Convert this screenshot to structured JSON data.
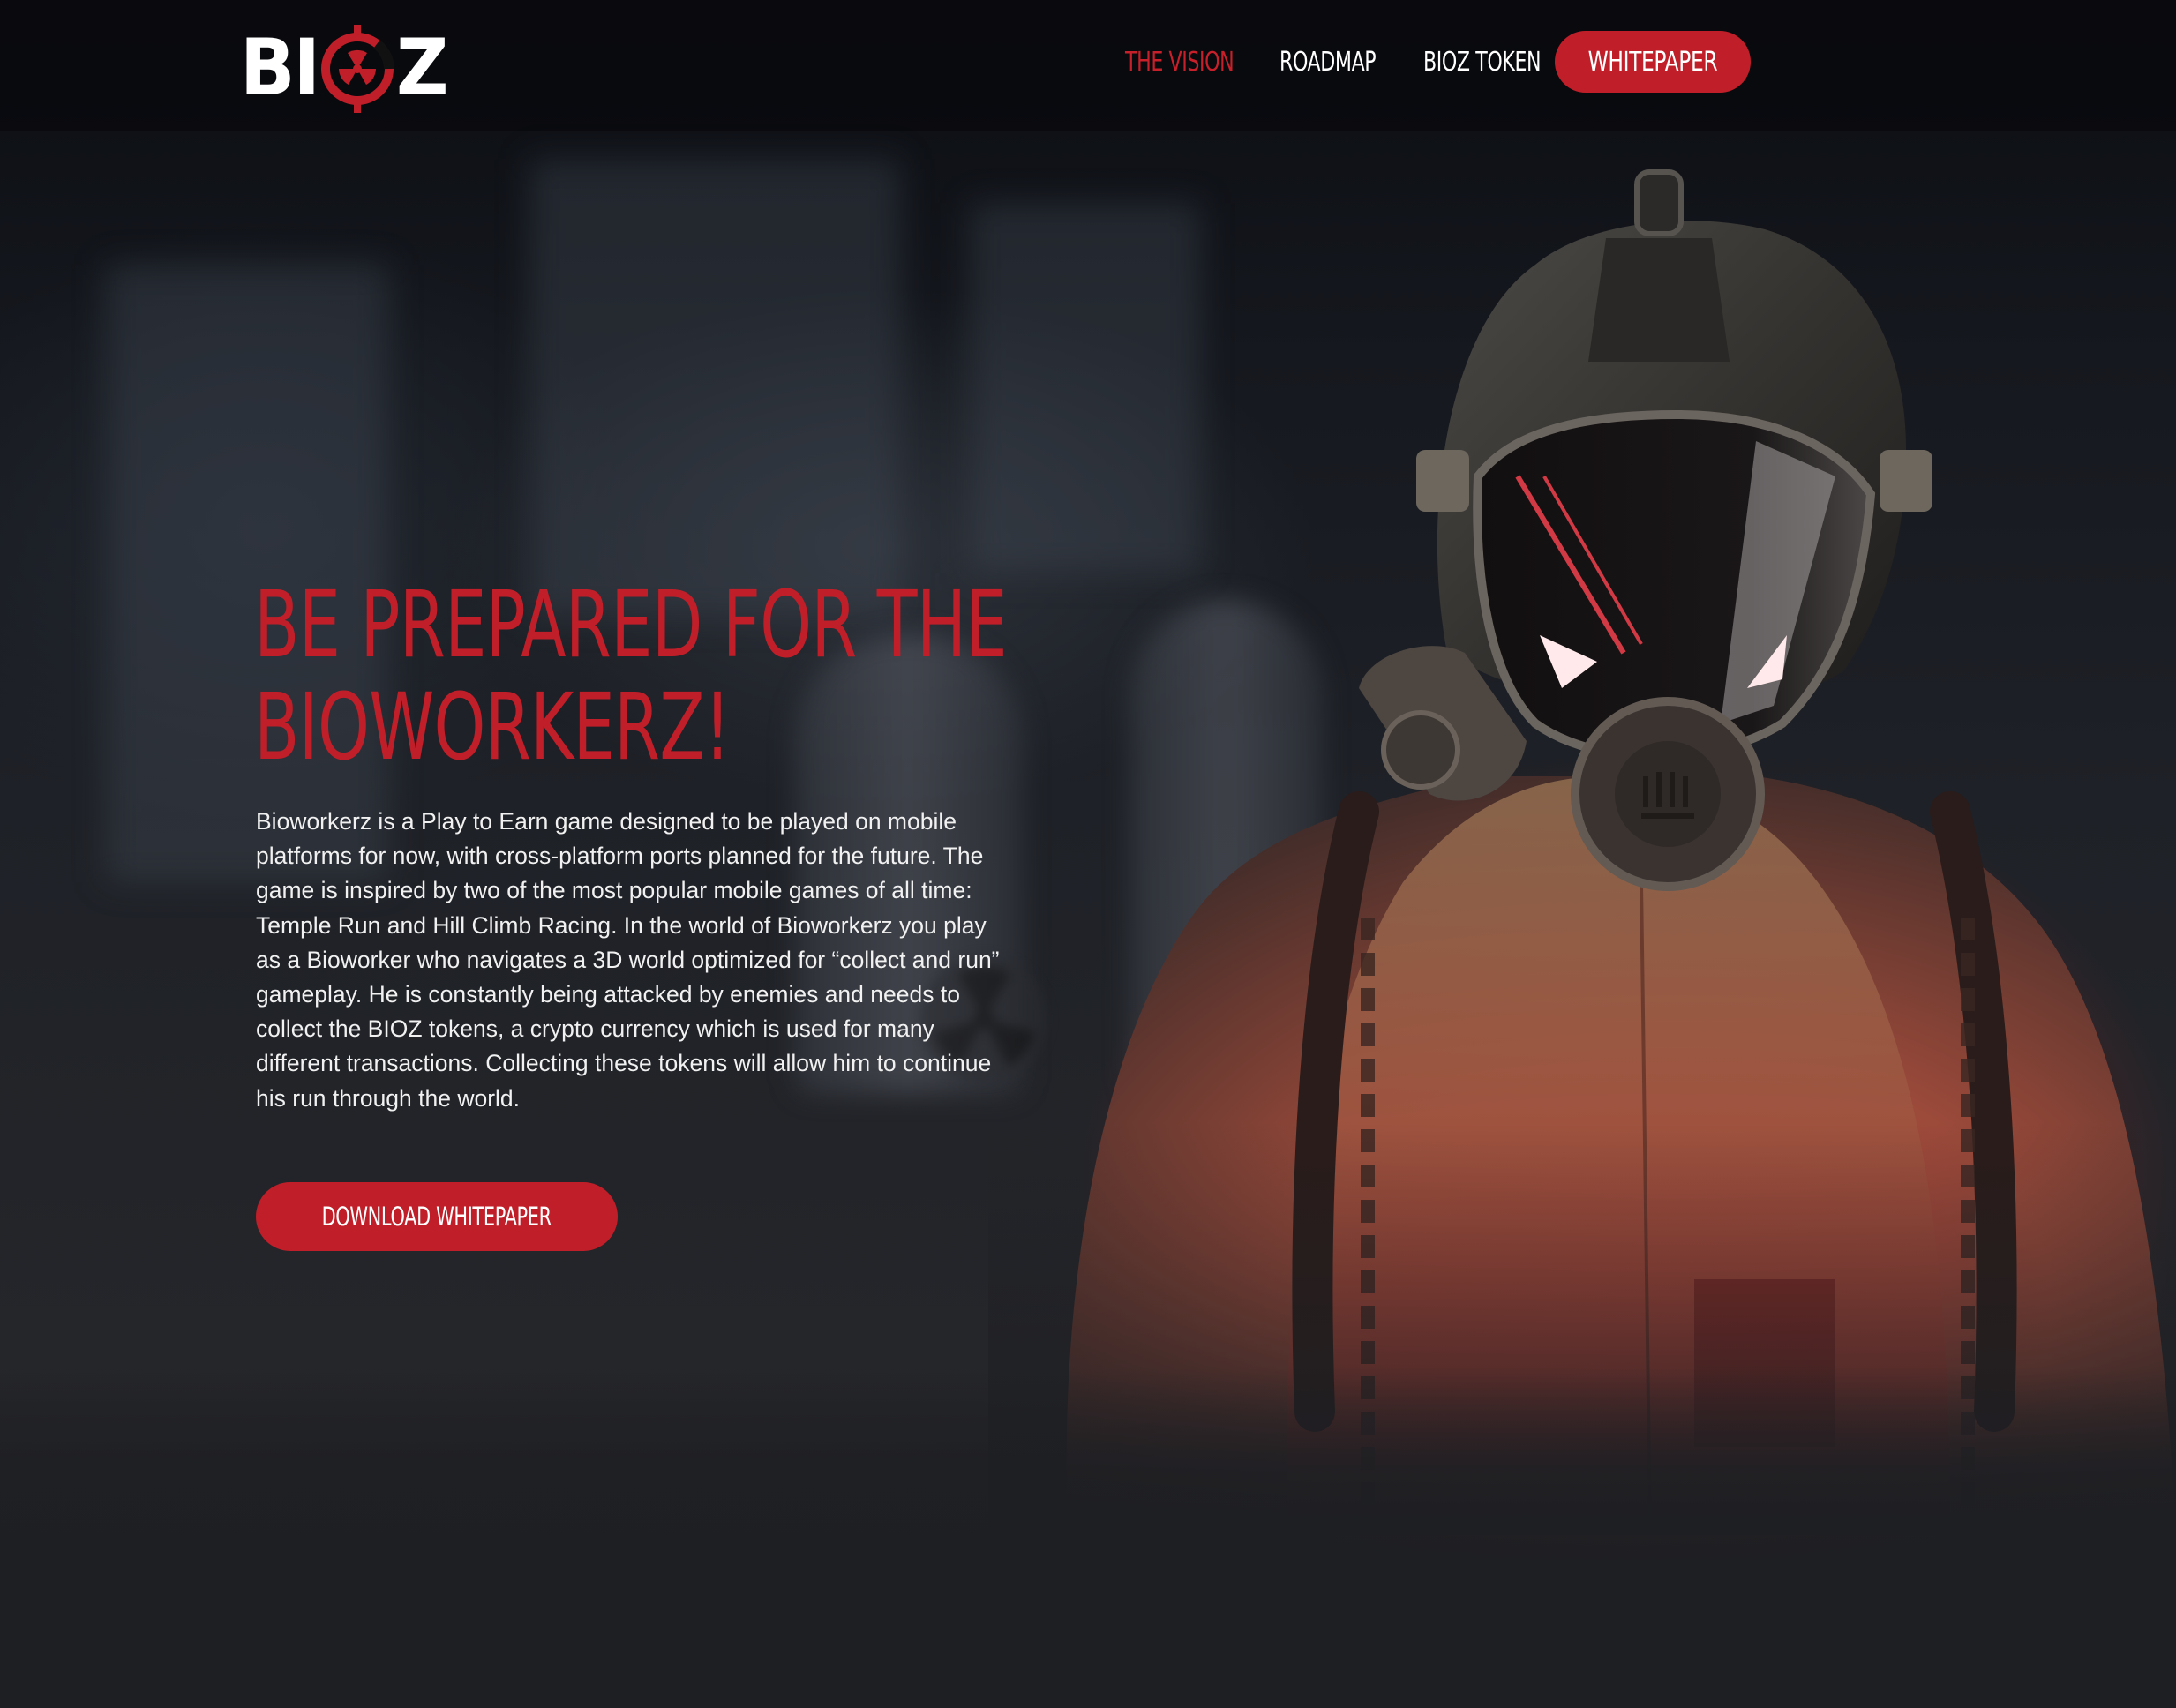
{
  "brand": {
    "logo_text_left": "BI",
    "logo_text_right": "Z",
    "accent_color": "#c01f29"
  },
  "nav": {
    "items": [
      {
        "label": "THE VISION",
        "active": true
      },
      {
        "label": "ROADMAP",
        "active": false
      },
      {
        "label": "BIOZ TOKEN",
        "active": false
      }
    ],
    "cta_label": "WHITEPAPER"
  },
  "hero": {
    "title_line1": "BE PREPARED FOR THE",
    "title_line2": "BIOWORKERZ!",
    "description": "Bioworkerz is a Play to Earn game designed to be played on mobile platforms for now, with cross-platform ports planned for the future. The game is inspired by two of the most popular mobile games of all time: Temple Run and Hill Climb Racing. In the world of Bioworkerz you play as a Bioworker who navigates a 3D world optimized for “collect and run” gameplay. He is constantly being attacked by enemies and needs to collect the BIOZ tokens, a crypto currency which is used for many different transactions. Collecting these tokens will allow him to continue his run through the world.",
    "button_label": "DOWNLOAD WHITEPAPER"
  },
  "icons": {
    "logo_mark": "radiation-coin-icon",
    "background_symbol": "radiation-hazard-icon"
  }
}
